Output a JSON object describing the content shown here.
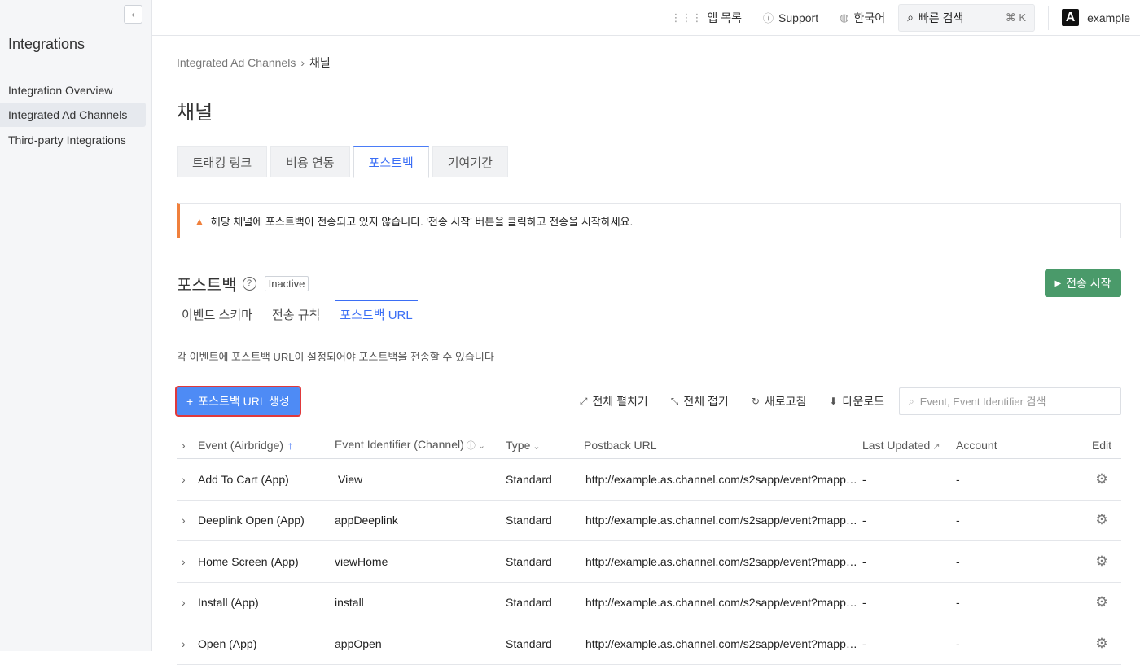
{
  "sidebar": {
    "collapse_icon": "chevron-left-icon",
    "title": "Integrations",
    "items": [
      {
        "label": "Integration Overview",
        "active": false
      },
      {
        "label": "Integrated Ad Channels",
        "active": true
      },
      {
        "label": "Third-party Integrations",
        "active": false
      }
    ]
  },
  "topbar": {
    "apps_label": "앱 목록",
    "support_label": "Support",
    "language_label": "한국어",
    "search_label": "빠른 검색",
    "search_shortcut": "⌘ K",
    "logo_letter": "A",
    "account_name": "example"
  },
  "breadcrumb": {
    "parent": "Integrated Ad Channels",
    "separator": "›",
    "current": "채널"
  },
  "page_title": "채널",
  "tabs": [
    {
      "label": "트래킹 링크",
      "active": false
    },
    {
      "label": "비용 연동",
      "active": false
    },
    {
      "label": "포스트백",
      "active": true
    },
    {
      "label": "기여기간",
      "active": false
    }
  ],
  "alert": {
    "icon": "warning-icon",
    "color": "#f0803c",
    "text": "해당 채널에 포스트백이 전송되고 있지 않습니다. '전송 시작' 버튼을 클릭하고 전송을 시작하세요."
  },
  "postback": {
    "title": "포스트백",
    "help_glyph": "?",
    "status": "Inactive",
    "start_button": "전송 시작",
    "start_color": "#4a9a6a"
  },
  "subtabs": [
    {
      "label": "이벤트 스키마",
      "active": false
    },
    {
      "label": "전송 규칙",
      "active": false
    },
    {
      "label": "포스트백 URL",
      "active": true
    }
  ],
  "description": "각 이벤트에 포스트백 URL이 설정되어야 포스트백을 전송할 수 있습니다",
  "toolbar": {
    "create_button": "포스트백 URL 생성",
    "expand_all": "전체 펼치기",
    "collapse_all": "전체 접기",
    "refresh": "새로고침",
    "download": "다운로드",
    "search_placeholder": "Event, Event Identifier 검색",
    "accent_color": "#4e8bf5"
  },
  "table": {
    "headers": {
      "event": "Event (Airbridge)",
      "identifier": "Event Identifier (Channel)",
      "type": "Type",
      "url": "Postback URL",
      "updated": "Last Updated",
      "account": "Account",
      "edit": "Edit"
    },
    "rows": [
      {
        "event": "Add To Cart (App)",
        "identifier": "View",
        "type": "Standard",
        "url": "http://example.as.channel.com/s2sapp/event?mappi...",
        "updated": "-",
        "account": "-"
      },
      {
        "event": "Deeplink Open (App)",
        "identifier": "appDeeplink",
        "type": "Standard",
        "url": "http://example.as.channel.com/s2sapp/event?mappi...",
        "updated": "-",
        "account": "-"
      },
      {
        "event": "Home Screen (App)",
        "identifier": "viewHome",
        "type": "Standard",
        "url": "http://example.as.channel.com/s2sapp/event?mappi...",
        "updated": "-",
        "account": "-"
      },
      {
        "event": "Install (App)",
        "identifier": "install",
        "type": "Standard",
        "url": "http://example.as.channel.com/s2sapp/event?mappi...",
        "updated": "-",
        "account": "-"
      },
      {
        "event": "Open (App)",
        "identifier": "appOpen",
        "type": "Standard",
        "url": "http://example.as.channel.com/s2sapp/event?mappi...",
        "updated": "-",
        "account": "-"
      }
    ]
  }
}
